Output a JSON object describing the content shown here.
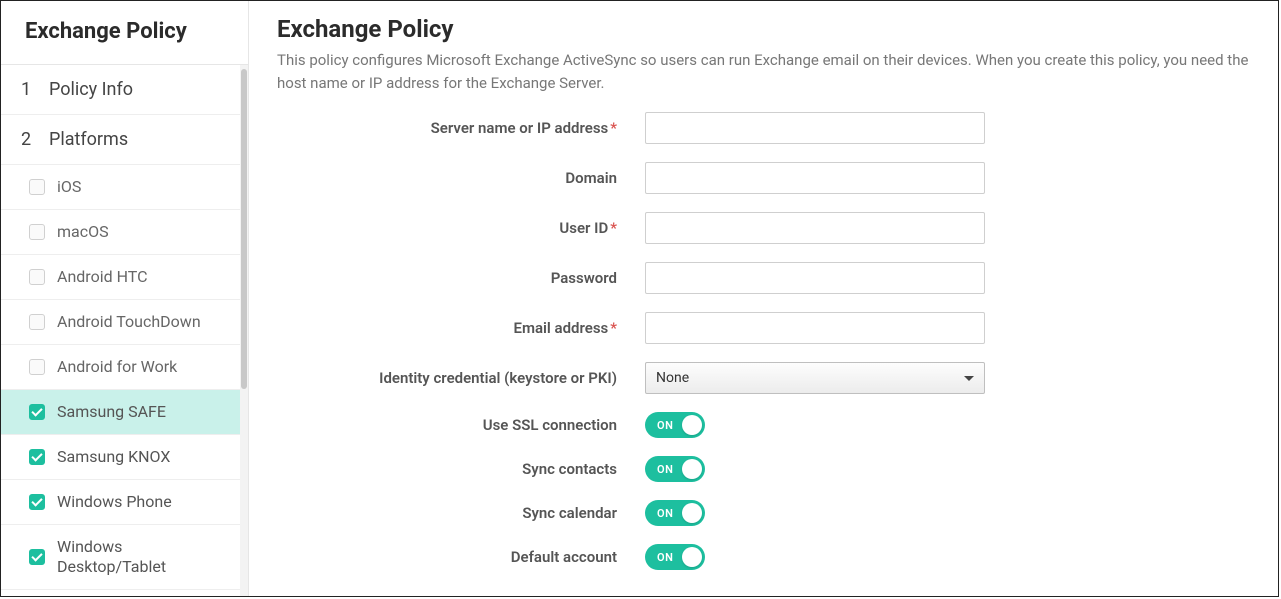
{
  "sidebar": {
    "title": "Exchange Policy",
    "steps": [
      {
        "num": "1",
        "label": "Policy Info"
      },
      {
        "num": "2",
        "label": "Platforms"
      }
    ],
    "platforms": [
      {
        "label": "iOS",
        "checked": false,
        "selected": false
      },
      {
        "label": "macOS",
        "checked": false,
        "selected": false
      },
      {
        "label": "Android HTC",
        "checked": false,
        "selected": false
      },
      {
        "label": "Android TouchDown",
        "checked": false,
        "selected": false
      },
      {
        "label": "Android for Work",
        "checked": false,
        "selected": false
      },
      {
        "label": "Samsung SAFE",
        "checked": true,
        "selected": true
      },
      {
        "label": "Samsung KNOX",
        "checked": true,
        "selected": false
      },
      {
        "label": "Windows Phone",
        "checked": true,
        "selected": false
      },
      {
        "label": "Windows Desktop/Tablet",
        "checked": true,
        "selected": false
      }
    ]
  },
  "main": {
    "title": "Exchange Policy",
    "description": "This policy configures Microsoft Exchange ActiveSync so users can run Exchange email on their devices. When you create this policy, you need the host name or IP address for the Exchange Server.",
    "fields": {
      "server": {
        "label": "Server name or IP address",
        "required": true,
        "value": ""
      },
      "domain": {
        "label": "Domain",
        "required": false,
        "value": ""
      },
      "userid": {
        "label": "User ID",
        "required": true,
        "value": ""
      },
      "password": {
        "label": "Password",
        "required": false,
        "value": ""
      },
      "email": {
        "label": "Email address",
        "required": true,
        "value": ""
      },
      "identity": {
        "label": "Identity credential (keystore or PKI)",
        "value": "None"
      },
      "ssl": {
        "label": "Use SSL connection",
        "state": "ON"
      },
      "contacts": {
        "label": "Sync contacts",
        "state": "ON"
      },
      "calendar": {
        "label": "Sync calendar",
        "state": "ON"
      },
      "default": {
        "label": "Default account",
        "state": "ON"
      }
    },
    "required_marker": "*"
  }
}
